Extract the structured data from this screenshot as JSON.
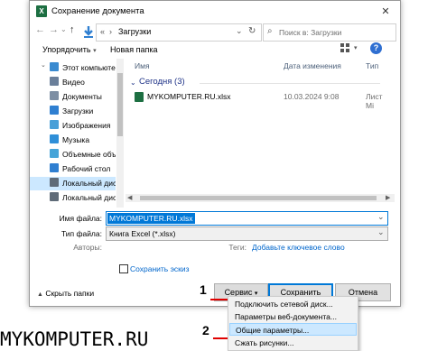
{
  "window": {
    "title": "Сохранение документа",
    "close_glyph": "✕",
    "app_icon_letter": "X"
  },
  "address": {
    "path_prefix": "«",
    "path_separator": "›",
    "path": "Загрузки",
    "search_placeholder": "Поиск в: Загрузки"
  },
  "toolbar": {
    "organize_label": "Упорядочить",
    "new_folder_label": "Новая папка"
  },
  "nav": {
    "items": [
      {
        "label": "Этот компьютер",
        "icon": "computer-icon",
        "color": "#3a8ad0"
      },
      {
        "label": "Видео",
        "icon": "video-icon",
        "color": "#6a7f9a"
      },
      {
        "label": "Документы",
        "icon": "documents-icon",
        "color": "#7d8ea3"
      },
      {
        "label": "Загрузки",
        "icon": "downloads-icon",
        "color": "#2f7fd1"
      },
      {
        "label": "Изображения",
        "icon": "pictures-icon",
        "color": "#4aa0d8"
      },
      {
        "label": "Музыка",
        "icon": "music-icon",
        "color": "#2f8fd8"
      },
      {
        "label": "Объемные объ",
        "icon": "3d-objects-icon",
        "color": "#46a4d8"
      },
      {
        "label": "Рабочий стол",
        "icon": "desktop-icon",
        "color": "#2f7fd1"
      },
      {
        "label": "Локальный дис",
        "icon": "drive-icon",
        "color": "#5f6b78",
        "selected": true
      },
      {
        "label": "Локальный дис",
        "icon": "drive-icon",
        "color": "#5f6b78"
      }
    ]
  },
  "filelist": {
    "columns": [
      "Имя",
      "Дата изменения",
      "Тип"
    ],
    "group_label": "Сегодня (3)",
    "files": [
      {
        "name": "MYKOMPUTER.RU.xlsx",
        "date": "10.03.2024 9:08",
        "type": "Лист Mi"
      }
    ]
  },
  "form": {
    "filename_label": "Имя файла:",
    "filename_value": "MYKOMPUTER.RU.xlsx",
    "filetype_label": "Тип файла:",
    "filetype_value": "Книга Excel (*.xlsx)",
    "authors_label": "Авторы:",
    "tags_label": "Теги:",
    "tags_link": "Добавьте ключевое слово",
    "thumbnail_label": "Сохранить эскиз",
    "hide_folders_label": "Скрыть папки"
  },
  "buttons": {
    "service_label": "Сервис",
    "save_label": "Сохранить",
    "cancel_label": "Отмена"
  },
  "menu": {
    "items": [
      {
        "label": "Подключить сетевой диск..."
      },
      {
        "label": "Параметры веб-документа..."
      },
      {
        "label": "Общие параметры...",
        "highlighted": true
      },
      {
        "label": "Сжать рисунки..."
      }
    ]
  },
  "callouts": {
    "one": "1",
    "two": "2"
  },
  "watermark": "MYKOMPUTER.RU",
  "colors": {
    "accent": "#0078d7",
    "excel_green": "#1d6f42",
    "red": "#e00000"
  }
}
